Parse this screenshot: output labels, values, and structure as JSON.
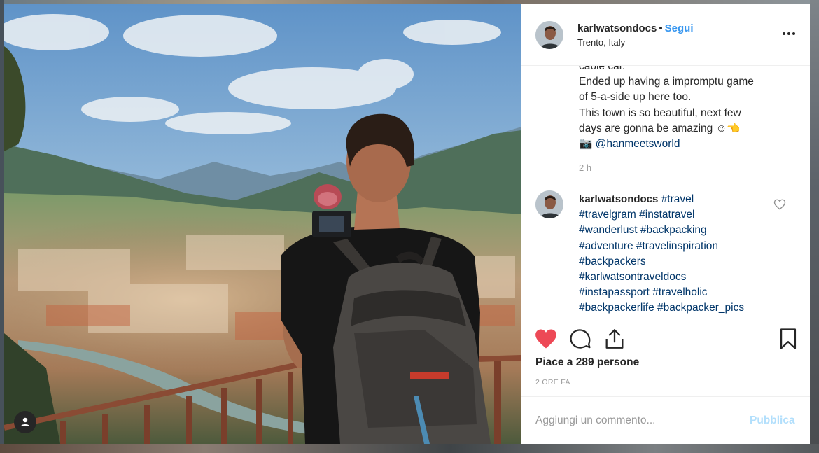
{
  "post": {
    "username": "karlwatsondocs",
    "separator": "•",
    "follow_label": "Segui",
    "location": "Trento, Italy",
    "more_icon": "more-options-icon"
  },
  "caption": {
    "lines": [
      "cable car.",
      "Ended up having a impromptu game",
      "of 5-a-side up here too.",
      "This town is so beautiful, next few",
      "days are gonna be amazing ☺👈"
    ],
    "credit_icon": "📷",
    "mention": "@hanmeetsworld",
    "time": "2 h"
  },
  "comment": {
    "username": "karlwatsondocs",
    "first_tag": "#travel",
    "lines": [
      "#travelgram #instatravel",
      "#wanderlust #backpacking",
      "#adventure #travelinspiration",
      "#backpackers",
      "#karlwatsontraveldocs",
      "#instapassport #travelholic",
      "#backpackerlife #backpacker_pics"
    ]
  },
  "actions": {
    "likes_prefix": "Piace a ",
    "likes_count": "289",
    "likes_suffix": " persone",
    "time_label": "2 ORE FA",
    "liked": true
  },
  "add_comment": {
    "placeholder": "Aggiungi un commento...",
    "publish_label": "Pubblica"
  },
  "colors": {
    "like_red": "#ed4956",
    "link_blue": "#3897f0",
    "hashtag": "#003569",
    "muted": "#999999",
    "publish_disabled": "#b2dffc"
  }
}
